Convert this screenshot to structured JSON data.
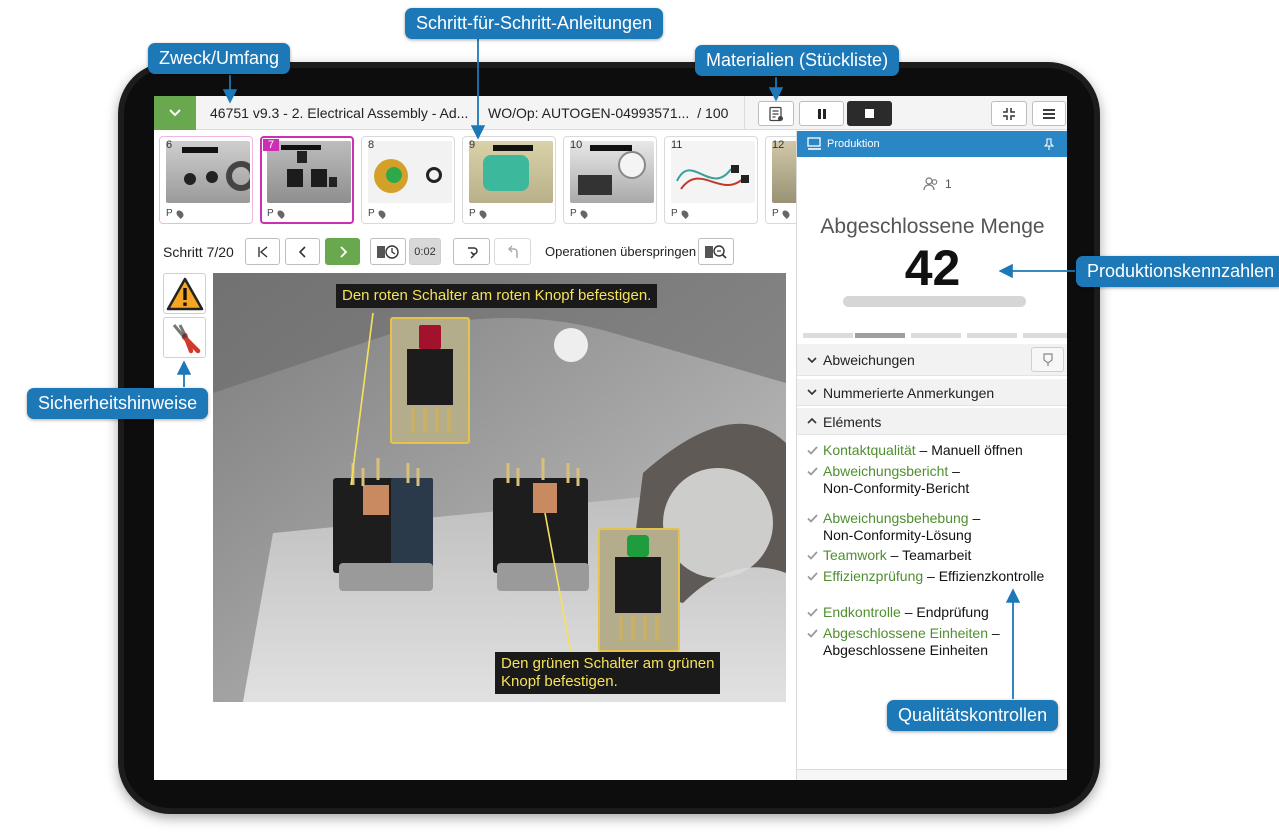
{
  "topbar": {
    "title": "46751 v9.3 - 2. Electrical Assembly - Ad...",
    "wo_op": "WO/Op:  AUTOGEN-04993571...",
    "quantity": "/ 100"
  },
  "thumbnails": [
    {
      "num": "6",
      "p": "P"
    },
    {
      "num": "7",
      "p": "P"
    },
    {
      "num": "8",
      "p": "P"
    },
    {
      "num": "9",
      "p": "P"
    },
    {
      "num": "10",
      "p": "P"
    },
    {
      "num": "11",
      "p": "P"
    },
    {
      "num": "12",
      "p": "P"
    }
  ],
  "stepnav": {
    "step": "Schritt 7/20",
    "timer": "0:02",
    "skip_label": "Operationen überspringen"
  },
  "main_image": {
    "callout_red": "Den roten Schalter am roten Knopf befestigen.",
    "callout_green_line1": "Den grünen Schalter am grünen",
    "callout_green_line2": "Knopf befestigen."
  },
  "panel": {
    "header": "Produktion",
    "users": "1",
    "qty_label": "Abgeschlossene Menge",
    "qty_value": "42",
    "progress": 0,
    "sections": {
      "deviations": "Abweichungen",
      "annotations": "Nummerierte Anmerkungen",
      "elements": "Eléments"
    },
    "items": [
      {
        "link": "Kontaktqualität",
        "rest1": " – Manuell öffnen",
        "rest2": ""
      },
      {
        "link": "Abweichungsbericht",
        "rest1": " –",
        "rest2": "Non-Conformity-Bericht"
      },
      {
        "link": "Abweichungsbehebung",
        "rest1": " –",
        "rest2": "Non-Conformity-Lösung"
      },
      {
        "link": "Teamwork",
        "rest1": " – Teamarbeit",
        "rest2": ""
      },
      {
        "link": "Effizienzprüfung",
        "rest1": " – Effizienzkontrolle",
        "rest2": ""
      },
      {
        "link": "Endkontrolle",
        "rest1": " – Endprüfung",
        "rest2": ""
      },
      {
        "link": "Abgeschlossene Einheiten",
        "rest1": " –",
        "rest2": "Abgeschlossene Einheiten"
      }
    ]
  },
  "annotations": {
    "purpose": "Zweck/Umfang",
    "steps": "Schritt-für-Schritt-Anleitungen",
    "materials": "Materialien (Stückliste)",
    "kpis": "Produktionskennzahlen",
    "safety": "Sicherheitshinweise",
    "quality": "Qualitätskontrollen"
  },
  "colors": {
    "accent_green": "#6aa84f",
    "active_magenta": "#cc2fb3",
    "header_blue": "#2b86c5",
    "annotation_blue": "#1d78b8",
    "link_green": "#4f8f2f",
    "callout_yellow": "#f6e25a"
  }
}
